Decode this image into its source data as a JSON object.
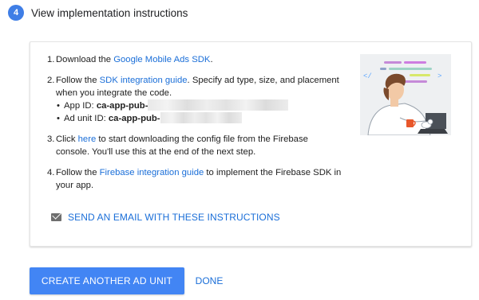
{
  "step": {
    "number": "4",
    "title": "View implementation instructions"
  },
  "instructions": {
    "items": [
      {
        "num": "1.",
        "pre": "Download the ",
        "link": "Google Mobile Ads SDK",
        "post": "."
      },
      {
        "num": "2.",
        "pre": "Follow the ",
        "link": "SDK integration guide",
        "post": ". Specify ad type, size, and placement when you integrate the code.",
        "sub": [
          {
            "label": "App ID: ",
            "value": "ca-app-pub-"
          },
          {
            "label": "Ad unit ID: ",
            "value": "ca-app-pub-"
          }
        ]
      },
      {
        "num": "3.",
        "pre": "Click ",
        "link": "here",
        "post": " to start downloading the config file from the Firebase console. You'll use this at the end of the next step."
      },
      {
        "num": "4.",
        "pre": "Follow the ",
        "link": "Firebase integration guide",
        "post": " to implement the Firebase SDK in your app."
      }
    ]
  },
  "email": {
    "icon": "mail-icon",
    "label": "SEND AN EMAIL WITH THESE INSTRUCTIONS"
  },
  "actions": {
    "create_label": "CREATE ANOTHER AD UNIT",
    "done_label": "DONE"
  },
  "colors": {
    "accent": "#4285f4",
    "link": "#1a6ed8",
    "step_badge": "#3f7ee6"
  }
}
